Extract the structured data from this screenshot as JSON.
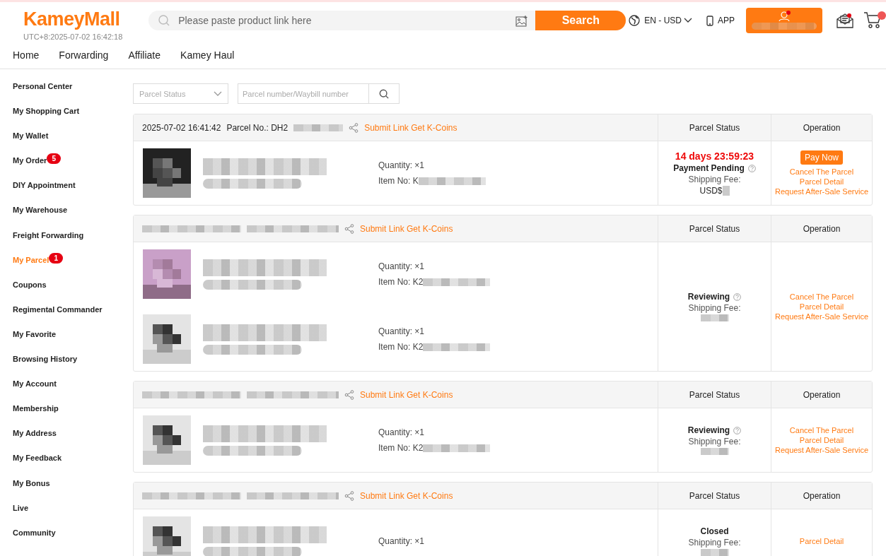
{
  "header": {
    "logo": "KameyMall",
    "clock": "UTC+8:2025-07-02 16:42:18",
    "search": {
      "placeholder": "Please paste product link here",
      "button": "Search"
    },
    "language": "EN - USD",
    "app": "APP"
  },
  "nav": [
    {
      "label": "Home"
    },
    {
      "label": "Forwarding"
    },
    {
      "label": "Affiliate"
    },
    {
      "label": "Kamey Haul"
    }
  ],
  "sidebar": [
    {
      "label": "Personal Center",
      "selected": false
    },
    {
      "label": "My Shopping Cart",
      "selected": false
    },
    {
      "label": "My Wallet",
      "selected": false
    },
    {
      "label": "My Order",
      "selected": false,
      "badge": "5"
    },
    {
      "label": "DIY Appointment",
      "selected": false
    },
    {
      "label": "My Warehouse",
      "selected": false
    },
    {
      "label": "Freight Forwarding",
      "selected": false
    },
    {
      "label": "My Parcel",
      "selected": true,
      "badge": "1"
    },
    {
      "label": "Coupons",
      "selected": false
    },
    {
      "label": "Regimental Commander",
      "selected": false
    },
    {
      "label": "My Favorite",
      "selected": false
    },
    {
      "label": "Browsing History",
      "selected": false
    },
    {
      "label": "My Account",
      "selected": false
    },
    {
      "label": "Membership",
      "selected": false
    },
    {
      "label": "My Address",
      "selected": false
    },
    {
      "label": "My Feedback",
      "selected": false
    },
    {
      "label": "My Bonus",
      "selected": false
    },
    {
      "label": "Live",
      "selected": false
    },
    {
      "label": "Community",
      "selected": false
    }
  ],
  "filters": {
    "status_placeholder": "Parcel Status",
    "number_placeholder": "Parcel number/Waybill number"
  },
  "parcels": [
    {
      "date": "2025-07-02 16:41:42",
      "parcel_no": "Parcel No.: DH2",
      "link": "Submit Link Get K-Coins",
      "status_heading": "Parcel Status",
      "operation_heading": "Operation",
      "items": [
        {
          "quantity": "Quantity: ×1",
          "item_no": "Item No: K"
        }
      ],
      "status": {
        "countdown": "14 days 23:59:23",
        "label": "Payment Pending",
        "help": true,
        "fee_label": "Shipping Fee:",
        "fee": "USD$"
      },
      "actions": [
        {
          "kind": "button",
          "label": "Pay Now"
        },
        {
          "kind": "link",
          "label": "Cancel The Parcel"
        },
        {
          "kind": "link",
          "label": "Parcel Detail"
        },
        {
          "kind": "link",
          "label": "Request After-Sale Service"
        }
      ]
    },
    {
      "link": "Submit Link Get K-Coins",
      "status_heading": "Parcel Status",
      "operation_heading": "Operation",
      "items": [
        {
          "quantity": "Quantity: ×1",
          "item_no": "Item No: K2"
        },
        {
          "quantity": "Quantity: ×1",
          "item_no": "Item No: K2"
        }
      ],
      "status": {
        "label": "Reviewing",
        "help": true,
        "fee_label": "Shipping Fee:"
      },
      "actions": [
        {
          "kind": "link",
          "label": "Cancel The Parcel"
        },
        {
          "kind": "link",
          "label": "Parcel Detail"
        },
        {
          "kind": "link",
          "label": "Request After-Sale Service"
        }
      ]
    },
    {
      "link": "Submit Link Get K-Coins",
      "status_heading": "Parcel Status",
      "operation_heading": "Operation",
      "items": [
        {
          "quantity": "Quantity: ×1",
          "item_no": "Item No: K2"
        }
      ],
      "status": {
        "label": "Reviewing",
        "help": true,
        "fee_label": "Shipping Fee:"
      },
      "actions": [
        {
          "kind": "link",
          "label": "Cancel The Parcel"
        },
        {
          "kind": "link",
          "label": "Parcel Detail"
        },
        {
          "kind": "link",
          "label": "Request After-Sale Service"
        }
      ]
    },
    {
      "link": "Submit Link Get K-Coins",
      "status_heading": "Parcel Status",
      "operation_heading": "Operation",
      "items": [
        {
          "quantity": "Quantity: ×1"
        }
      ],
      "status": {
        "label": "Closed",
        "help": false,
        "fee_label": "Shipping Fee:"
      },
      "actions": [
        {
          "kind": "link",
          "label": "Parcel Detail"
        }
      ]
    }
  ]
}
